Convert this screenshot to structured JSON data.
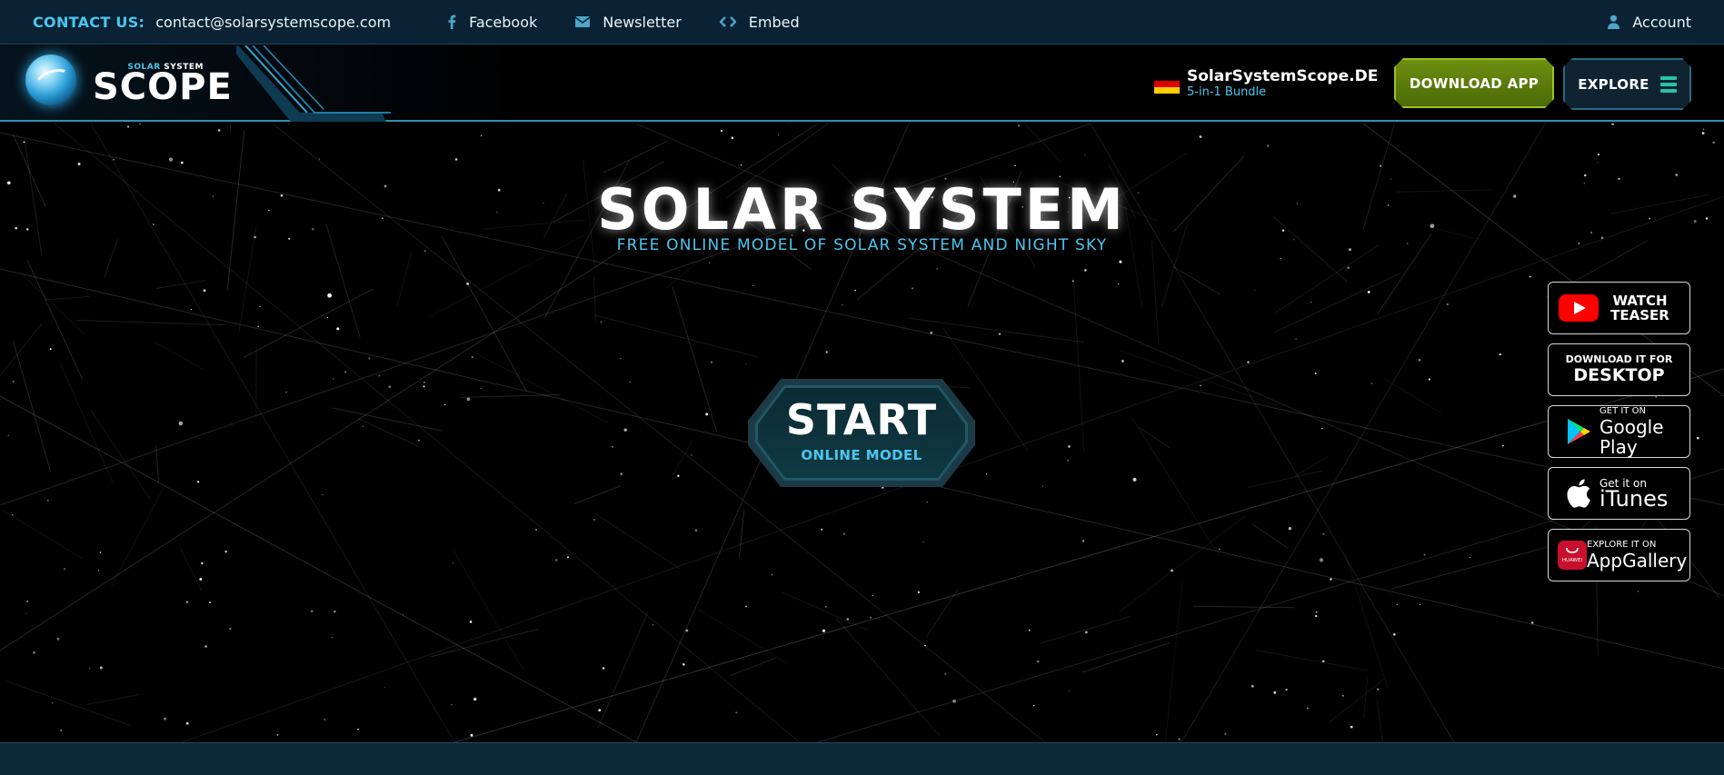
{
  "topbar": {
    "contact_label": "CONTACT US:",
    "contact_email": "contact@solarsystemscope.com",
    "links": [
      {
        "label": "Facebook",
        "icon": "facebook-icon"
      },
      {
        "label": "Newsletter",
        "icon": "envelope-icon"
      },
      {
        "label": "Embed",
        "icon": "embed-code-icon"
      }
    ],
    "account_label": "Account"
  },
  "header": {
    "logo_small_1": "SOLAR",
    "logo_small_2": "SYSTEM",
    "logo_big": "SCOPE",
    "de_title": "SolarSystemScope.DE",
    "de_sub": "5-in-1 Bundle",
    "download_label": "DOWNLOAD APP",
    "explore_label": "EXPLORE"
  },
  "hero": {
    "title": "SOLAR SYSTEM",
    "subtitle": "FREE ONLINE MODEL OF SOLAR SYSTEM AND NIGHT SKY",
    "start_label": "START",
    "start_sub": "ONLINE MODEL"
  },
  "stores": {
    "teaser": "WATCH TEASER",
    "desktop_small": "DOWNLOAD IT FOR",
    "desktop_big": "DESKTOP",
    "google_small": "GET IT ON",
    "google_big": "Google Play",
    "itunes_small": "Get it on",
    "itunes_big": "iTunes",
    "huawei_small": "EXPLORE IT ON",
    "huawei_big": "AppGallery",
    "huawei_badge": "HUAWEI"
  },
  "colors": {
    "accent": "#4cc6ef",
    "topbar_bg": "#0a2234",
    "download_green": "#6d8f10",
    "youtube_red": "#ff0000",
    "huawei_red": "#c8102e"
  }
}
